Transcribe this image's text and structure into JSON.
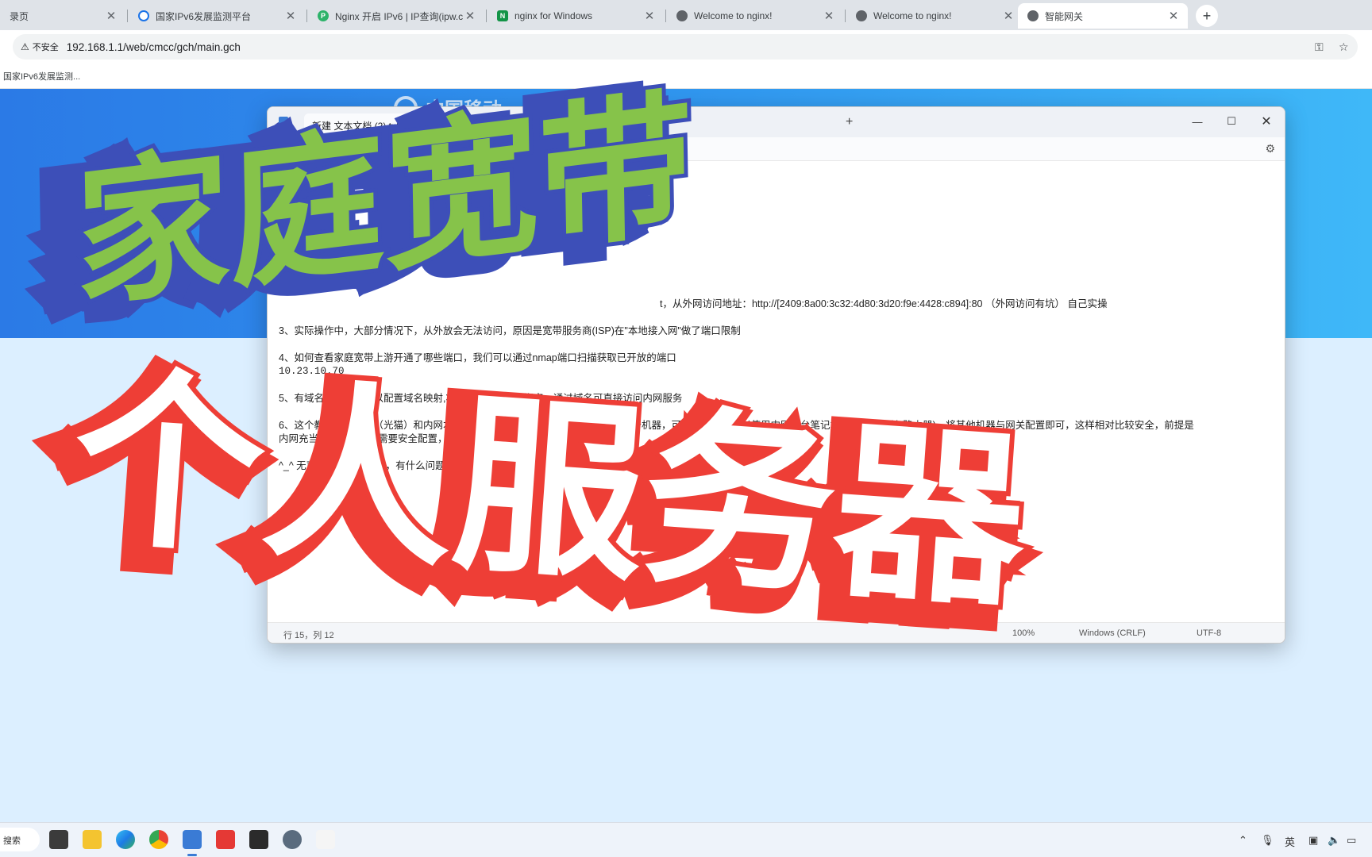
{
  "browser": {
    "tabs": [
      {
        "title": "录页",
        "favicon": "none",
        "active": false
      },
      {
        "title": "国家IPv6发展监测平台",
        "favicon": "globe-icon",
        "active": false
      },
      {
        "title": "Nginx 开启 IPv6 | IP查询(ipw.c",
        "favicon": "ipw-icon",
        "active": false
      },
      {
        "title": "nginx for Windows",
        "favicon": "nginx-icon",
        "active": false
      },
      {
        "title": "Welcome to nginx!",
        "favicon": "globe-icon",
        "active": false
      },
      {
        "title": "Welcome to nginx!",
        "favicon": "globe-icon",
        "active": false
      },
      {
        "title": "智能网关",
        "favicon": "globe-icon",
        "active": true
      }
    ],
    "tab_close_glyph": "✕",
    "new_tab_glyph": "+",
    "security_label": "不安全",
    "url": "192.168.1.1/web/cmcc/gch/main.gch",
    "bookmarks": [
      "国家IPv6发展监测..."
    ]
  },
  "page": {
    "logo_text": "中国移动"
  },
  "notepad": {
    "tab_title": "新建 文本文档 (2).txt",
    "tab_dot": "●",
    "lines": [
      {
        "text": "t，从外网访问地址：http://[2409:8a00:3c32:4d80:3d20:f9e:4428:c894]:80 （外网访问有坑） 自己实操",
        "indent": 480
      },
      {
        "text": "",
        "indent": 0
      },
      {
        "text": "3、实际操作中，大部分情况下，从外放会无法访问，原因是宽带服务商(ISP)在\"本地接入网\"做了端口限制",
        "indent": 0
      },
      {
        "text": "",
        "indent": 0
      },
      {
        "text": "4、如何查看家庭宽带上游开通了哪些端口，我们可以通过nmap端口扫描获取已开放的端口",
        "indent": 0
      },
      {
        "text": "10.23.10.70",
        "indent": 0,
        "mono": true
      },
      {
        "text": "",
        "indent": 0
      },
      {
        "text": "5、有域名的同学，可以配置域名映射,将ipv6地址和域名绑定，通过域名可直接访问内网服务",
        "indent": 0
      },
      {
        "text": "",
        "indent": 0
      },
      {
        "text": "6、这个教程是光宽带（光猫）和内网本机直连的教程，如果想从外网访问内网多个机器，可购买路由器或者使用内网一台笔记本充当内网网关(路由器)，将其他机器与网关配置即可，这样相对比较安全，前提是",
        "indent": 0
      },
      {
        "text": "内网充当网关的路由器需要安全配置，下次有机会再出视频",
        "indent": 0
      },
      {
        "text": "",
        "indent": 0
      },
      {
        "text": "^_^ 无声视频，敬请海涵，有什么问题可以留言，我会第一时间回复的",
        "indent": 0
      }
    ],
    "status": {
      "position": "行 15，列 12",
      "zoom": "100%",
      "line_ending": "Windows (CRLF)",
      "encoding": "UTF-8"
    }
  },
  "overlay": {
    "caption_top": "家庭宽带",
    "caption_bottom": "个人服务器"
  },
  "taskbar": {
    "search_label": "搜索",
    "ime_label": "英"
  },
  "colors": {
    "caption_top_fill": "#86c34a",
    "caption_top_outline": "#3d4fb8",
    "caption_bottom_fill": "#ffffff",
    "caption_bottom_outline": "#ee3e36",
    "banner_blue": "#2b7ae6"
  }
}
